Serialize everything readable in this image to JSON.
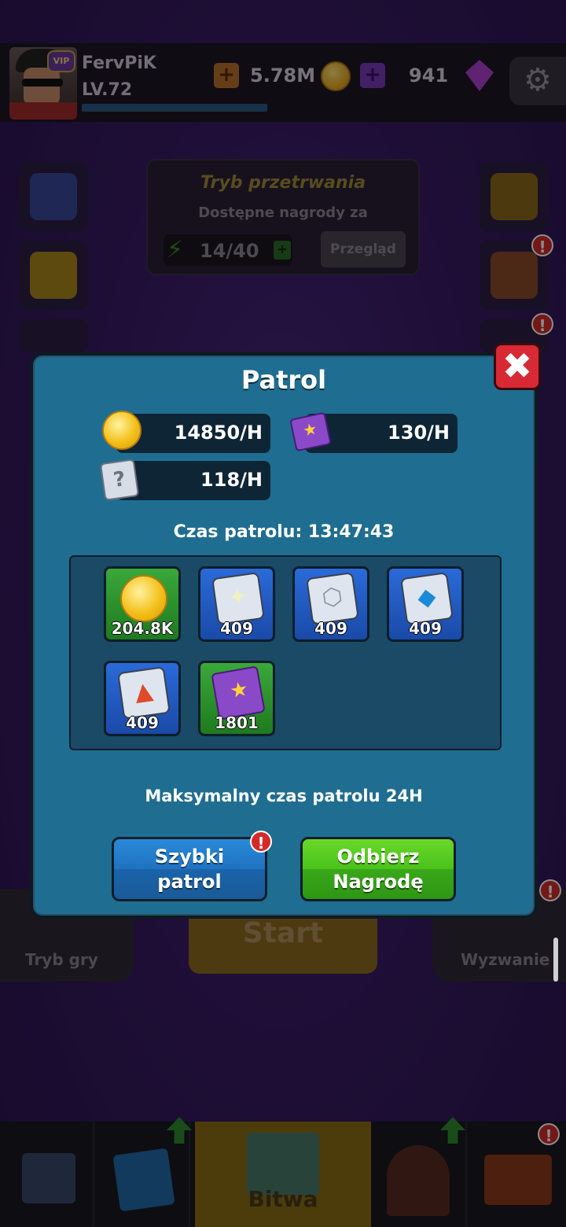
{
  "player": {
    "name": "FervPiK",
    "level": "LV.72",
    "vip": "VIP"
  },
  "resources": {
    "gold": "5.78M",
    "gems": "941"
  },
  "survival": {
    "title": "Tryb przetrwania",
    "subtitle": "Dostępne nagrody za",
    "energy": "14/40",
    "review_label": "Przegląd"
  },
  "modes": {
    "left": "Tryb gry",
    "right": "Wyzwanie",
    "start": "Start"
  },
  "nav": {
    "battle": "Bitwa"
  },
  "patrol": {
    "title": "Patrol",
    "rates": {
      "gold": "14850/H",
      "books": "130/H",
      "cards": "118/H"
    },
    "time_label": "Czas patrolu: 13:47:43",
    "rewards": [
      {
        "type": "gold",
        "amount": "204.8K",
        "bg": "green",
        "icon": "coin-icon"
      },
      {
        "type": "card-light",
        "amount": "409",
        "bg": "blue",
        "icon": "light-card-icon"
      },
      {
        "type": "card-nut",
        "amount": "409",
        "bg": "blue",
        "icon": "nut-card-icon"
      },
      {
        "type": "card-ice",
        "amount": "409",
        "bg": "blue",
        "icon": "ice-card-icon"
      },
      {
        "type": "card-fire",
        "amount": "409",
        "bg": "blue",
        "icon": "fire-card-icon"
      },
      {
        "type": "book",
        "amount": "1801",
        "bg": "green",
        "icon": "book-icon"
      }
    ],
    "max_time": "Maksymalny czas patrolu 24H",
    "quick_patrol_label": [
      "Szybki",
      "patrol"
    ],
    "claim_label": [
      "Odbierz",
      "Nagrodę"
    ]
  },
  "colors": {
    "modal_bg": "#1f6d91",
    "close": "#d82a34",
    "quick_btn": "#1f72c0",
    "claim_btn": "#4ac21a"
  }
}
